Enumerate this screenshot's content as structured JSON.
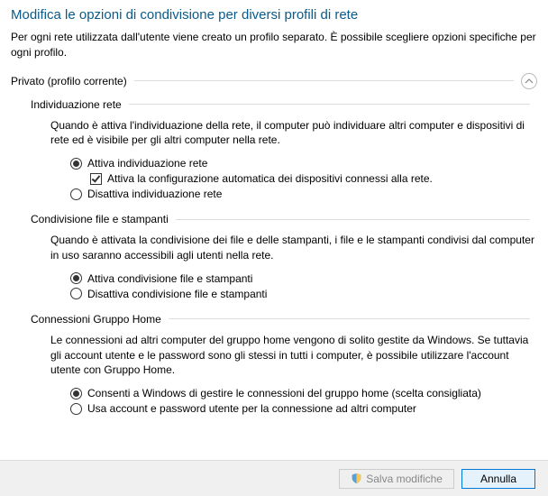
{
  "title": "Modifica le opzioni di condivisione per diversi profili di rete",
  "subtitle": "Per ogni rete utilizzata dall'utente viene creato un profilo separato. È possibile scegliere opzioni specifiche per ogni profilo.",
  "profile_header": "Privato (profilo corrente)",
  "sections": {
    "network_discovery": {
      "title": "Individuazione rete",
      "desc": "Quando è attiva l'individuazione della rete, il computer può individuare altri computer e dispositivi di rete ed è visibile per gli altri computer nella rete.",
      "radio_on": "Attiva individuazione rete",
      "checkbox_auto": "Attiva la configurazione automatica dei dispositivi connessi alla rete.",
      "radio_off": "Disattiva individuazione rete"
    },
    "file_sharing": {
      "title": "Condivisione file e stampanti",
      "desc": "Quando è attivata la condivisione dei file e delle stampanti, i file e le stampanti condivisi dal computer in uso saranno accessibili agli utenti nella rete.",
      "radio_on": "Attiva condivisione file e stampanti",
      "radio_off": "Disattiva condivisione file e stampanti"
    },
    "homegroup": {
      "title": "Connessioni Gruppo Home",
      "desc": "Le connessioni ad altri computer del gruppo home vengono di solito gestite da Windows. Se tuttavia gli account utente e le password sono gli stessi in tutti i computer, è possibile utilizzare l'account utente con Gruppo Home.",
      "radio_windows": "Consenti a Windows di gestire le connessioni del gruppo home (scelta consigliata)",
      "radio_user": "Usa account e password utente per la connessione ad altri computer"
    }
  },
  "buttons": {
    "save": "Salva modifiche",
    "cancel": "Annulla"
  }
}
